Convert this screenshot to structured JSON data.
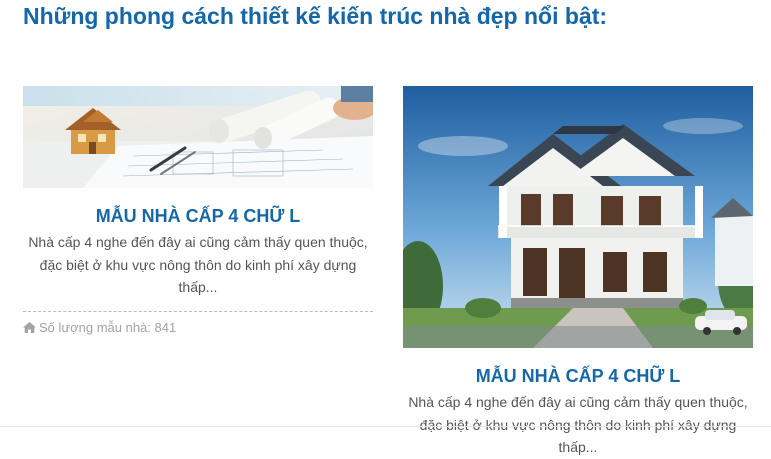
{
  "section": {
    "heading": "Những phong cách thiết kế kiến trúc nhà đẹp nổi bật:"
  },
  "cards": [
    {
      "image": "blueprint-house-model-image",
      "title": "MẪU NHÀ CẤP 4 CHỮ L",
      "description": "Nhà cấp 4 nghe đến đây ai cũng cảm thấy quen thuộc, đặc biệt ở khu vực nông thôn do kinh phí xây dựng thấp...",
      "count_label": "Số lượng mẫu nhà: 841",
      "count_icon": "home-icon"
    },
    {
      "image": "two-storey-villa-image",
      "title": "MẪU NHÀ CẤP 4 CHỮ L",
      "description": "Nhà cấp 4 nghe đến đây ai cũng cảm thấy quen thuộc, đặc biệt ở khu vực nông thôn do kinh phí xây dựng thấp..."
    }
  ],
  "colors": {
    "heading": "#1467a9",
    "title": "#1467a9",
    "text": "#555555",
    "muted": "#a3a3a3"
  }
}
